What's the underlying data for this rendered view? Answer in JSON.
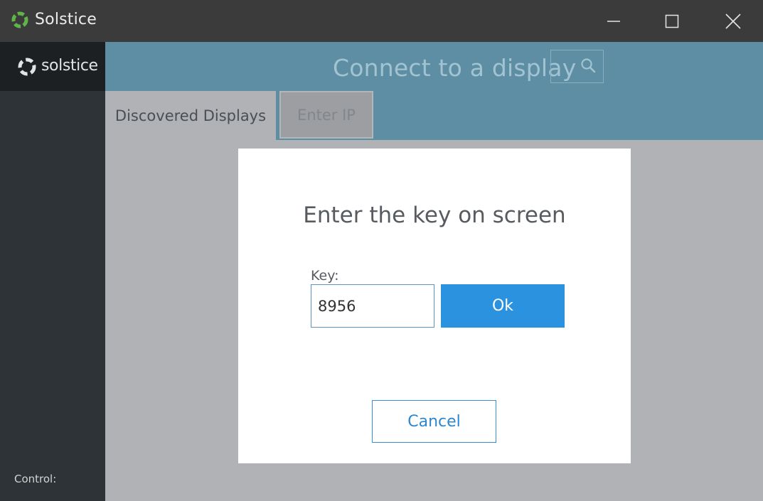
{
  "window": {
    "title": "Solstice",
    "icon": "solstice-app-icon"
  },
  "sidebar": {
    "logo_text": "solstice",
    "control_label": "Control:"
  },
  "main": {
    "title": "Connect to a display",
    "search_icon": "search-icon",
    "tabs": [
      {
        "label": "Discovered Displays",
        "active": true
      },
      {
        "label": "Enter IP",
        "active": false
      }
    ]
  },
  "dialog": {
    "title": "Enter the key on screen",
    "key_label": "Key:",
    "key_value": "8956",
    "ok_label": "Ok",
    "cancel_label": "Cancel"
  },
  "colors": {
    "accent": "#2a92df",
    "header": "#5e8ea4",
    "sidebar": "#2d3337",
    "brand_green": "#4caf50"
  }
}
